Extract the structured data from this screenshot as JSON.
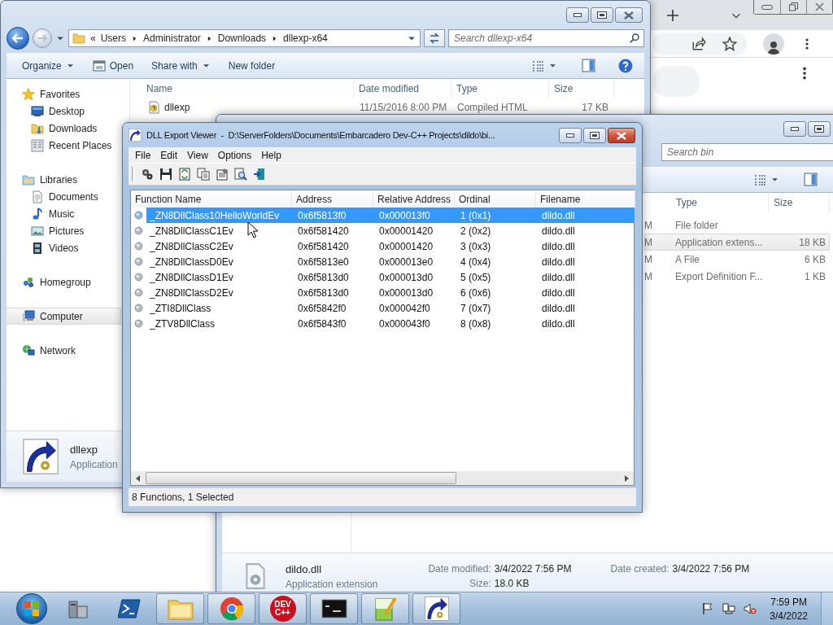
{
  "explorer_main": {
    "path_overflow": "«",
    "path": [
      "Users",
      "Administrator",
      "Downloads",
      "dllexp-x64"
    ],
    "search": {
      "placeholder": "Search dllexp-x64"
    },
    "toolbar": [
      {
        "label": "Organize",
        "kind": "menu"
      },
      {
        "label": "Open",
        "kind": "open"
      },
      {
        "label": "Share with",
        "kind": "menu"
      },
      {
        "label": "New folder",
        "kind": "plain"
      }
    ],
    "nav": [
      {
        "label": "Favorites",
        "kind": "star",
        "selected": false,
        "children": [
          {
            "label": "Desktop",
            "kind": "desktop",
            "selected": false
          },
          {
            "label": "Downloads",
            "kind": "downloads",
            "selected": false
          },
          {
            "label": "Recent Places",
            "kind": "recent",
            "selected": false
          }
        ]
      },
      {
        "label": "Libraries",
        "kind": "libraries",
        "selected": false,
        "children": [
          {
            "label": "Documents",
            "kind": "documents",
            "selected": false
          },
          {
            "label": "Music",
            "kind": "music",
            "selected": false
          },
          {
            "label": "Pictures",
            "kind": "pictures",
            "selected": false
          },
          {
            "label": "Videos",
            "kind": "videos",
            "selected": false
          }
        ]
      },
      {
        "label": "Homegroup",
        "kind": "homegroup",
        "selected": false
      },
      {
        "label": "Computer",
        "kind": "computer",
        "selected": true
      },
      {
        "label": "Network",
        "kind": "network",
        "selected": false
      }
    ],
    "columns": [
      "Name",
      "Date modified",
      "Type",
      "Size"
    ],
    "rows": [
      {
        "name": "dllexp",
        "date_modified": "11/15/2016 8:00 PM",
        "type": "Compiled HTML",
        "size": "17 KB"
      }
    ],
    "details": {
      "name": "dllexp",
      "type": "Application"
    }
  },
  "explorer_bin": {
    "search": {
      "placeholder": "Search bin"
    },
    "columns": [
      "Type",
      "Size"
    ],
    "rows": [
      {
        "date_modified": "M",
        "type": "File folder",
        "selected": false
      },
      {
        "date_modified": "M",
        "type": "Application extens...",
        "size": "18 KB",
        "selected": true
      },
      {
        "date_modified": "M",
        "type": "A File",
        "size": "6 KB",
        "selected": false
      },
      {
        "date_modified": "M",
        "type": "Export Definition F...",
        "size": "1 KB",
        "selected": false
      }
    ],
    "details": {
      "name": "dildo.dll",
      "type": "Application extension",
      "fields": [
        {
          "label": "Date modified:",
          "value": "3/4/2022 7:56 PM"
        },
        {
          "label": "Size:",
          "value": "18.0 KB"
        },
        {
          "label": "Date created:",
          "value": "3/4/2022 7:56 PM"
        }
      ]
    }
  },
  "dll_viewer": {
    "title": "DLL Export Viewer  -  D:\\ServerFolders\\Documents\\Embarcadero Dev-C++ Projects\\dildo\\bi...",
    "menu": [
      "File",
      "Edit",
      "View",
      "Options",
      "Help"
    ],
    "columns": [
      "Function Name",
      "Address",
      "Relative Address",
      "Ordinal",
      "Filename"
    ],
    "rows": [
      {
        "cells": [
          "_ZN8DllClass10HelloWorldEv",
          "0x6f5813f0",
          "0x000013f0",
          "1 (0x1)",
          "dildo.dll"
        ],
        "selected": true
      },
      {
        "cells": [
          "_ZN8DllClassC1Ev",
          "0x6f581420",
          "0x00001420",
          "2 (0x2)",
          "dildo.dll"
        ],
        "selected": false
      },
      {
        "cells": [
          "_ZN8DllClassC2Ev",
          "0x6f581420",
          "0x00001420",
          "3 (0x3)",
          "dildo.dll"
        ],
        "selected": false
      },
      {
        "cells": [
          "_ZN8DllClassD0Ev",
          "0x6f5813e0",
          "0x000013e0",
          "4 (0x4)",
          "dildo.dll"
        ],
        "selected": false
      },
      {
        "cells": [
          "_ZN8DllClassD1Ev",
          "0x6f5813d0",
          "0x000013d0",
          "5 (0x5)",
          "dildo.dll"
        ],
        "selected": false
      },
      {
        "cells": [
          "_ZN8DllClassD2Ev",
          "0x6f5813d0",
          "0x000013d0",
          "6 (0x6)",
          "dildo.dll"
        ],
        "selected": false
      },
      {
        "cells": [
          "_ZTI8DllClass",
          "0x6f5842f0",
          "0x000042f0",
          "7 (0x7)",
          "dildo.dll"
        ],
        "selected": false
      },
      {
        "cells": [
          "_ZTV8DllClass",
          "0x6f5843f0",
          "0x000043f0",
          "8 (0x8)",
          "dildo.dll"
        ],
        "selected": false
      }
    ],
    "status": "8 Functions, 1 Selected"
  },
  "taskbar": {
    "apps": [
      {
        "kind": "server",
        "running": false
      },
      {
        "kind": "powershell",
        "running": false
      },
      {
        "kind": "explorer",
        "running": true
      },
      {
        "kind": "chrome",
        "running": true
      },
      {
        "kind": "devcpp",
        "running": true,
        "badge": [
          "DEV",
          "C++"
        ]
      },
      {
        "kind": "cmd",
        "running": true
      },
      {
        "kind": "notepad",
        "running": true
      },
      {
        "kind": "dllexp",
        "running": true
      }
    ],
    "clock": {
      "time": "7:59 PM",
      "date": "3/4/2022"
    }
  }
}
